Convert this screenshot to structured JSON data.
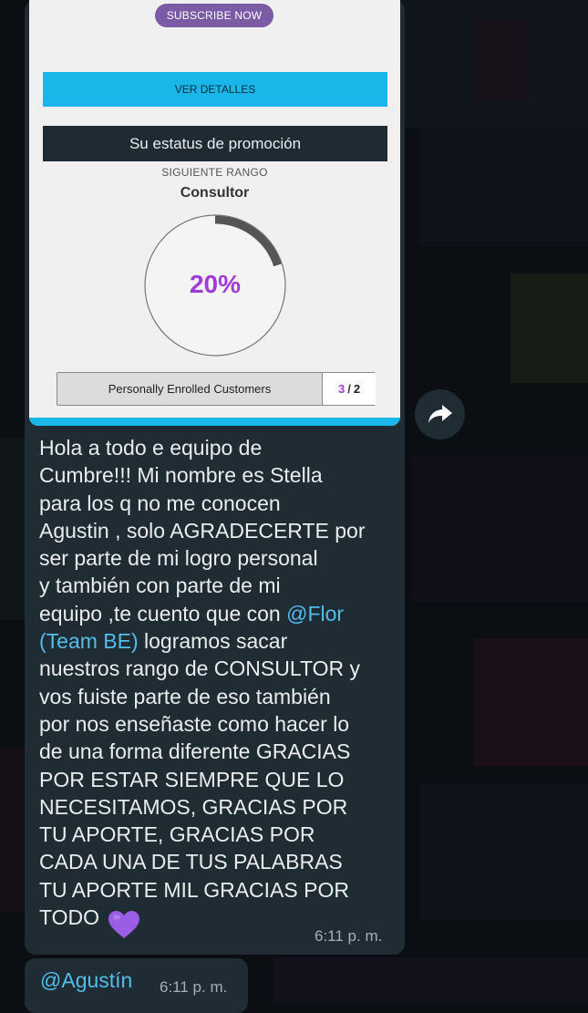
{
  "promo_card": {
    "subscribe_label": "SUBSCRIBE NOW",
    "details_label": "VER DETALLES",
    "status_title": "Su estatus de promoción",
    "next_rank_label": "SIGUIENTE RANGO",
    "next_rank": "Consultor",
    "progress_percent_text": "20%",
    "progress_fraction": 0.2,
    "metric_label": "Personally Enrolled Customers",
    "metric_current": "3",
    "metric_separator": "/",
    "metric_goal": "2"
  },
  "message": {
    "text_before_mention": "Hola a todo e equipo de\nCumbre!!! Mi nombre es Stella\npara los q no me conocen\nAgustin , solo AGRADECERTE  por\nser parte de mi logro personal\ny también con parte de mi\nequipo ,te cuento que con ",
    "mention": "@Flor\n(Team BE)",
    "text_after_mention": " logramos sacar\nnuestros rango de CONSULTOR y\nvos fuiste parte de eso también\npor nos enseñaste como hacer lo\nde una forma diferente GRACIAS\nPOR ESTAR SIEMPRE QUE LO\nNECESITAMOS, GRACIAS POR\nTU APORTE, GRACIAS POR\nCADA UNA DE TUS PALABRAS\nTU APORTE MIL GRACIAS POR\nTODO",
    "emoji": "purple-heart",
    "time": "6:11 p. m."
  },
  "reply": {
    "mention": "@Agustín",
    "time": "6:11 p. m."
  },
  "colors": {
    "bubble": "#1f2c34",
    "mention": "#53bdeb",
    "accent_purple": "#a23bd6",
    "accent_blue": "#19b6ea"
  }
}
